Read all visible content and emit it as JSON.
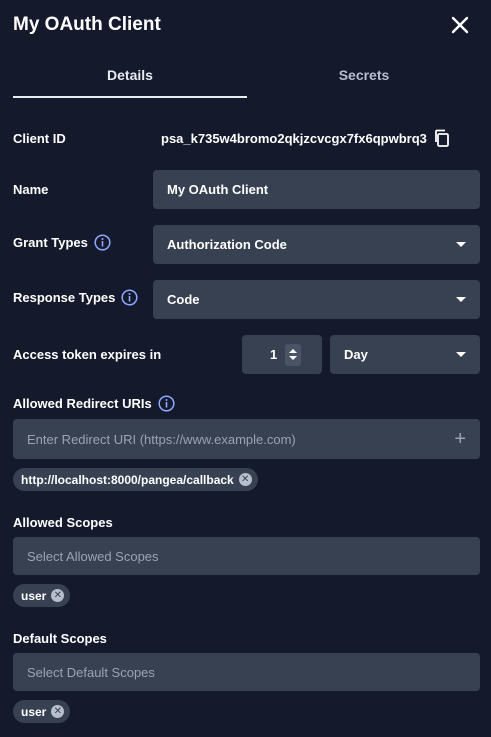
{
  "header": {
    "title": "My OAuth Client"
  },
  "tabs": [
    {
      "label": "Details"
    },
    {
      "label": "Secrets"
    }
  ],
  "client_id": {
    "label": "Client ID",
    "value": "psa_k735w4bromo2qkjzcvcgx7fx6qpwbrq3"
  },
  "name": {
    "label": "Name",
    "value": "My OAuth Client"
  },
  "grant_types": {
    "label": "Grant Types",
    "value": "Authorization Code"
  },
  "response_types": {
    "label": "Response Types",
    "value": "Code"
  },
  "access_token": {
    "label": "Access token expires in",
    "amount": "1",
    "unit": "Day"
  },
  "redirect_uris": {
    "label": "Allowed Redirect URIs",
    "placeholder": "Enter Redirect URI (https://www.example.com)",
    "chips": [
      "http://localhost:8000/pangea/callback"
    ]
  },
  "allowed_scopes": {
    "label": "Allowed Scopes",
    "placeholder": "Select Allowed Scopes",
    "chips": [
      "user"
    ]
  },
  "default_scopes": {
    "label": "Default Scopes",
    "placeholder": "Select Default Scopes",
    "chips": [
      "user"
    ]
  },
  "colors": {
    "background": "#141a2c",
    "field": "#384152",
    "text": "#ffffff",
    "placeholder": "#9aa3b5"
  },
  "icons": {
    "close": "close-icon",
    "info": "info-icon",
    "copy": "copy-icon",
    "dropdown": "chevron-down-icon",
    "add": "plus-icon",
    "remove": "remove-chip-icon"
  }
}
